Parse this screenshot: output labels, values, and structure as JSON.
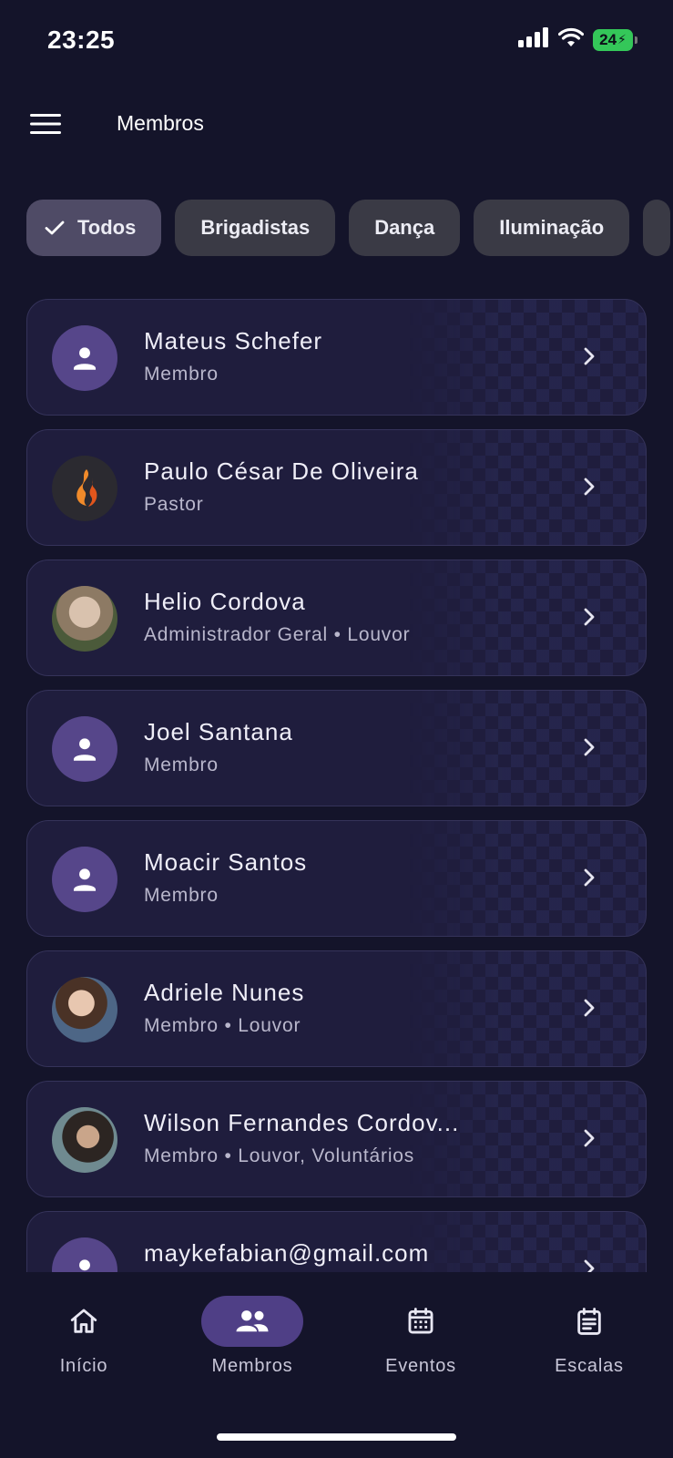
{
  "status_bar": {
    "time": "23:25",
    "battery": "24"
  },
  "app_bar": {
    "title": "Membros",
    "menu_icon": "hamburger-menu-icon"
  },
  "filters": [
    {
      "label": "Todos",
      "selected": true
    },
    {
      "label": "Brigadistas",
      "selected": false
    },
    {
      "label": "Dança",
      "selected": false
    },
    {
      "label": "Iluminação",
      "selected": false
    }
  ],
  "members": [
    {
      "name": "Mateus Schefer",
      "role": "Membro",
      "avatar": "person-icon"
    },
    {
      "name": "Paulo César De Oliveira",
      "role": "Pastor",
      "avatar": "flame-logo"
    },
    {
      "name": "Helio Cordova",
      "role": "Administrador Geral • Louvor",
      "avatar": "photo"
    },
    {
      "name": "Joel Santana",
      "role": "Membro",
      "avatar": "person-icon"
    },
    {
      "name": "Moacir Santos",
      "role": "Membro",
      "avatar": "person-icon"
    },
    {
      "name": "Adriele Nunes",
      "role": "Membro • Louvor",
      "avatar": "photo"
    },
    {
      "name": "Wilson Fernandes Cordov...",
      "role": "Membro • Louvor, Voluntários",
      "avatar": "photo"
    },
    {
      "name": "maykefabian@gmail.com",
      "role": "",
      "avatar": "person-icon"
    }
  ],
  "bottom_nav": [
    {
      "label": "Início",
      "icon": "home-icon",
      "active": false
    },
    {
      "label": "Membros",
      "icon": "group-icon",
      "active": true
    },
    {
      "label": "Eventos",
      "icon": "calendar-icon",
      "active": false
    },
    {
      "label": "Escalas",
      "icon": "schedule-list-icon",
      "active": false
    }
  ],
  "colors": {
    "background": "#14142a",
    "card": "#1f1d3d",
    "chip": "#3a3a45",
    "chip_selected": "#4f4b66",
    "avatar": "#56468a",
    "nav_active": "#4f3f86",
    "battery": "#34c759"
  }
}
